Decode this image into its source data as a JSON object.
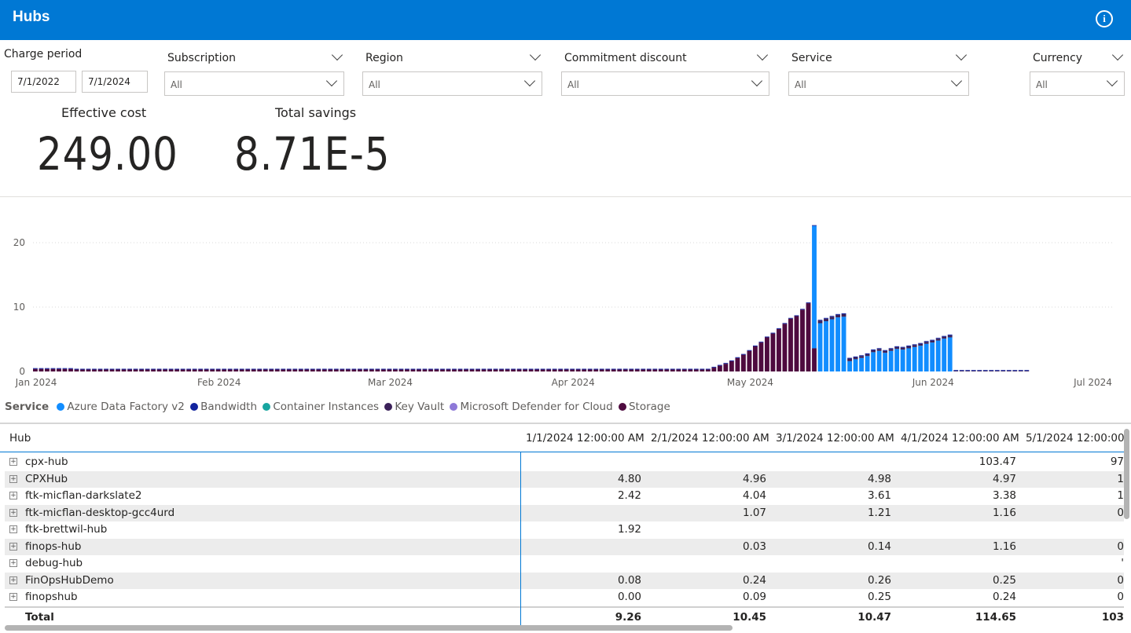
{
  "header": {
    "title": "Hubs",
    "info_glyph": "i"
  },
  "filters": {
    "charge_period": {
      "label": "Charge period",
      "start": "7/1/2022",
      "end": "7/1/2024"
    },
    "subscription": {
      "label": "Subscription",
      "value": "All"
    },
    "region": {
      "label": "Region",
      "value": "All"
    },
    "commitment_discount": {
      "label": "Commitment discount",
      "value": "All"
    },
    "service": {
      "label": "Service",
      "value": "All"
    },
    "currency": {
      "label": "Currency",
      "value": "All"
    }
  },
  "kpis": {
    "effective_cost": {
      "label": "Effective cost",
      "value": "249.00"
    },
    "total_savings": {
      "label": "Total savings",
      "value": "8.71E-5"
    }
  },
  "legend": {
    "title": "Service",
    "items": [
      {
        "label": "Azure Data Factory v2",
        "color": "#118dff"
      },
      {
        "label": "Bandwidth",
        "color": "#12239e"
      },
      {
        "label": "Container Instances",
        "color": "#17a5a0"
      },
      {
        "label": "Key Vault",
        "color": "#3b2159"
      },
      {
        "label": "Microsoft Defender for Cloud",
        "color": "#8e79d8"
      },
      {
        "label": "Storage",
        "color": "#4e0b3f"
      }
    ]
  },
  "chart_data": {
    "type": "bar",
    "stacked": true,
    "x_start": "2024-01-01",
    "x_tick_labels": [
      "Jan 2024",
      "Feb 2024",
      "Mar 2024",
      "Apr 2024",
      "May 2024",
      "Jun 2024",
      "Jul 2024"
    ],
    "y_ticks": [
      0,
      10,
      20
    ],
    "ylim": [
      0,
      25
    ],
    "grid": true,
    "legend_position": "bottom-left",
    "colors": {
      "adf": "#118dff",
      "storage": "#4e0b3f",
      "keyvault": "#3b2159",
      "bandwidth": "#12239e"
    },
    "series": [
      {
        "name": "Storage",
        "values": [
          0.4,
          0.4,
          0.4,
          0.4,
          0.4,
          0.4,
          0.4,
          0.3,
          0.3,
          0.3,
          0.3,
          0.3,
          0.3,
          0.3,
          0.3,
          0.3,
          0.3,
          0.3,
          0.3,
          0.3,
          0.3,
          0.3,
          0.3,
          0.3,
          0.3,
          0.3,
          0.3,
          0.3,
          0.3,
          0.3,
          0.3,
          0.3,
          0.3,
          0.3,
          0.3,
          0.3,
          0.3,
          0.3,
          0.3,
          0.3,
          0.3,
          0.3,
          0.3,
          0.3,
          0.3,
          0.3,
          0.3,
          0.3,
          0.3,
          0.3,
          0.3,
          0.3,
          0.3,
          0.3,
          0.3,
          0.3,
          0.3,
          0.3,
          0.3,
          0.3,
          0.3,
          0.3,
          0.3,
          0.3,
          0.3,
          0.3,
          0.3,
          0.3,
          0.3,
          0.3,
          0.3,
          0.3,
          0.3,
          0.3,
          0.3,
          0.3,
          0.3,
          0.3,
          0.3,
          0.3,
          0.3,
          0.3,
          0.3,
          0.3,
          0.3,
          0.3,
          0.3,
          0.3,
          0.3,
          0.3,
          0.3,
          0.3,
          0.3,
          0.3,
          0.3,
          0.3,
          0.3,
          0.3,
          0.3,
          0.3,
          0.3,
          0.3,
          0.3,
          0.3,
          0.3,
          0.3,
          0.3,
          0.3,
          0.3,
          0.3,
          0.3,
          0.3,
          0.3,
          0.3,
          0.3,
          0.6,
          0.9,
          1.2,
          1.6,
          2.1,
          2.6,
          3.2,
          3.9,
          4.5,
          5.3,
          5.9,
          6.6,
          7.4,
          8.2,
          8.6,
          9.6,
          10.6,
          3.6,
          0,
          0,
          0,
          0,
          0,
          0,
          0,
          0,
          0,
          0,
          0,
          0,
          0,
          0,
          0,
          0,
          0,
          0,
          0,
          0,
          0,
          0,
          0,
          0,
          0,
          0,
          0,
          0,
          0,
          0,
          0,
          0,
          0,
          0,
          0,
          0,
          0,
          0,
          0,
          0,
          0,
          0,
          0,
          0,
          0,
          0
        ]
      },
      {
        "name": "Azure Data Factory v2",
        "values": [
          0,
          0,
          0,
          0,
          0,
          0,
          0,
          0,
          0,
          0,
          0,
          0,
          0,
          0,
          0,
          0,
          0,
          0,
          0,
          0,
          0,
          0,
          0,
          0,
          0,
          0,
          0,
          0,
          0,
          0,
          0,
          0,
          0,
          0,
          0,
          0,
          0,
          0,
          0,
          0,
          0,
          0,
          0,
          0,
          0,
          0,
          0,
          0,
          0,
          0,
          0,
          0,
          0,
          0,
          0,
          0,
          0,
          0,
          0,
          0,
          0,
          0,
          0,
          0,
          0,
          0,
          0,
          0,
          0,
          0,
          0,
          0,
          0,
          0,
          0,
          0,
          0,
          0,
          0,
          0,
          0,
          0,
          0,
          0,
          0,
          0,
          0,
          0,
          0,
          0,
          0,
          0,
          0,
          0,
          0,
          0,
          0,
          0,
          0,
          0,
          0,
          0,
          0,
          0,
          0,
          0,
          0,
          0,
          0,
          0,
          0,
          0,
          0,
          0,
          0,
          0,
          0,
          0,
          0,
          0,
          0,
          0,
          0,
          0,
          0,
          0,
          0,
          0,
          0,
          0,
          0,
          0,
          19.0,
          7.5,
          7.8,
          8.1,
          8.4,
          8.5,
          1.6,
          1.9,
          2.1,
          2.4,
          3.0,
          3.2,
          2.9,
          3.2,
          3.5,
          3.4,
          3.6,
          3.8,
          4.0,
          4.3,
          4.5,
          4.8,
          5.1,
          5.3,
          0,
          0,
          0,
          0,
          0,
          0,
          0,
          0,
          0,
          0,
          0,
          0,
          0,
          0,
          0,
          0,
          0,
          0,
          0,
          0,
          0,
          0,
          0,
          0,
          0,
          0,
          0,
          0,
          0,
          0,
          0,
          0,
          0
        ]
      },
      {
        "name": "Key Vault",
        "values": [
          0,
          0,
          0,
          0,
          0,
          0,
          0,
          0,
          0,
          0,
          0,
          0,
          0,
          0,
          0,
          0,
          0,
          0,
          0,
          0,
          0,
          0,
          0,
          0,
          0,
          0,
          0,
          0,
          0,
          0,
          0,
          0,
          0,
          0,
          0,
          0,
          0,
          0,
          0,
          0,
          0,
          0,
          0,
          0,
          0,
          0,
          0,
          0,
          0,
          0,
          0,
          0,
          0,
          0,
          0,
          0,
          0,
          0,
          0,
          0,
          0,
          0,
          0,
          0,
          0,
          0,
          0,
          0,
          0,
          0,
          0,
          0,
          0,
          0,
          0,
          0,
          0,
          0,
          0,
          0,
          0,
          0,
          0,
          0,
          0,
          0,
          0,
          0,
          0,
          0,
          0,
          0,
          0,
          0,
          0,
          0,
          0,
          0,
          0,
          0,
          0,
          0,
          0,
          0,
          0,
          0,
          0,
          0,
          0,
          0,
          0,
          0,
          0,
          0,
          0,
          0,
          0,
          0,
          0,
          0,
          0,
          0,
          0,
          0,
          0,
          0,
          0,
          0,
          0,
          0,
          0,
          0,
          0,
          0.4,
          0.4,
          0.4,
          0.4,
          0.4,
          0.4,
          0.3,
          0.3,
          0.3,
          0.3,
          0.3,
          0.3,
          0.3,
          0.3,
          0.3,
          0.3,
          0.3,
          0.3,
          0.3,
          0.3,
          0.3,
          0.3,
          0.3,
          0.1,
          0.1,
          0.1,
          0.1,
          0.1,
          0.1,
          0.1,
          0.1,
          0.1,
          0.1,
          0.1,
          0.1,
          0.1,
          0,
          0,
          0,
          0,
          0,
          0,
          0,
          0,
          0,
          0,
          0,
          0,
          0,
          0,
          0,
          0,
          0,
          0,
          0,
          0,
          0,
          0,
          0,
          0,
          0,
          0
        ]
      }
    ]
  },
  "table": {
    "row_header": "Hub",
    "columns": [
      "1/1/2024 12:00:00 AM",
      "2/1/2024 12:00:00 AM",
      "3/1/2024 12:00:00 AM",
      "4/1/2024 12:00:00 AM",
      "5/1/2024 12:00:00"
    ],
    "rows": [
      {
        "name": "cpx-hub",
        "cells": [
          "",
          "",
          "",
          "103.47",
          "97"
        ]
      },
      {
        "name": "CPXHub",
        "cells": [
          "4.80",
          "4.96",
          "4.98",
          "4.97",
          "1"
        ]
      },
      {
        "name": "ftk-micflan-darkslate2",
        "cells": [
          "2.42",
          "4.04",
          "3.61",
          "3.38",
          "1"
        ]
      },
      {
        "name": "ftk-micflan-desktop-gcc4urd",
        "cells": [
          "",
          "1.07",
          "1.21",
          "1.16",
          "0"
        ]
      },
      {
        "name": "ftk-brettwil-hub",
        "cells": [
          "1.92",
          "",
          "",
          "",
          ""
        ]
      },
      {
        "name": "finops-hub",
        "cells": [
          "",
          "0.03",
          "0.14",
          "1.16",
          "0"
        ]
      },
      {
        "name": "debug-hub",
        "cells": [
          "",
          "",
          "",
          "",
          "'"
        ]
      },
      {
        "name": "FinOpsHubDemo",
        "cells": [
          "0.08",
          "0.24",
          "0.26",
          "0.25",
          "0"
        ]
      },
      {
        "name": "finopshub",
        "cells": [
          "0.00",
          "0.09",
          "0.25",
          "0.24",
          "0"
        ]
      }
    ],
    "total": {
      "label": "Total",
      "cells": [
        "9.26",
        "10.45",
        "10.47",
        "114.65",
        "103"
      ]
    },
    "expand_glyph": "+"
  }
}
